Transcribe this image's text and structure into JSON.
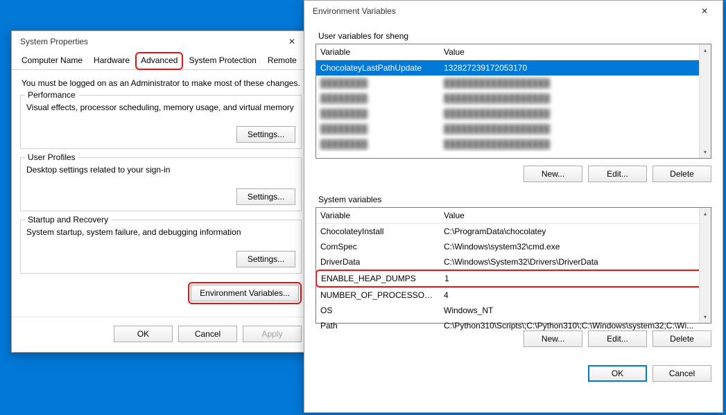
{
  "sysprops": {
    "title": "System Properties",
    "tabs": [
      "Computer Name",
      "Hardware",
      "Advanced",
      "System Protection",
      "Remote"
    ],
    "active_tab_index": 2,
    "note": "You must be logged on as an Administrator to make most of these changes.",
    "groups": {
      "performance": {
        "legend": "Performance",
        "desc": "Visual effects, processor scheduling, memory usage, and virtual memory",
        "button": "Settings..."
      },
      "user_profiles": {
        "legend": "User Profiles",
        "desc": "Desktop settings related to your sign-in",
        "button": "Settings..."
      },
      "startup": {
        "legend": "Startup and Recovery",
        "desc": "System startup, system failure, and debugging information",
        "button": "Settings..."
      }
    },
    "env_button": "Environment Variables...",
    "ok": "OK",
    "cancel": "Cancel",
    "apply": "Apply"
  },
  "envdlg": {
    "title": "Environment Variables",
    "user_section": "User variables for sheng",
    "sys_section": "System variables",
    "col_variable": "Variable",
    "col_value": "Value",
    "user_vars": [
      {
        "name": "ChocolateyLastPathUpdate",
        "value": "132827239172053170",
        "selected": true
      },
      {
        "name": "",
        "value": "",
        "blurred": true
      },
      {
        "name": "",
        "value": "",
        "blurred": true
      },
      {
        "name": "",
        "value": "",
        "blurred": true
      },
      {
        "name": "",
        "value": "",
        "blurred": true
      },
      {
        "name": "",
        "value": "",
        "blurred": true
      }
    ],
    "sys_vars": [
      {
        "name": "ChocolateyInstall",
        "value": "C:\\ProgramData\\chocolatey"
      },
      {
        "name": "ComSpec",
        "value": "C:\\Windows\\system32\\cmd.exe"
      },
      {
        "name": "DriverData",
        "value": "C:\\Windows\\System32\\Drivers\\DriverData"
      },
      {
        "name": "ENABLE_HEAP_DUMPS",
        "value": "1",
        "highlighted": true
      },
      {
        "name": "NUMBER_OF_PROCESSORS",
        "value": "4"
      },
      {
        "name": "OS",
        "value": "Windows_NT"
      },
      {
        "name": "Path",
        "value": "C:\\Python310\\Scripts\\;C:\\Python310\\;C:\\Windows\\system32;C:\\Wi..."
      }
    ],
    "new": "New...",
    "edit": "Edit...",
    "delete": "Delete",
    "ok": "OK",
    "cancel": "Cancel"
  }
}
